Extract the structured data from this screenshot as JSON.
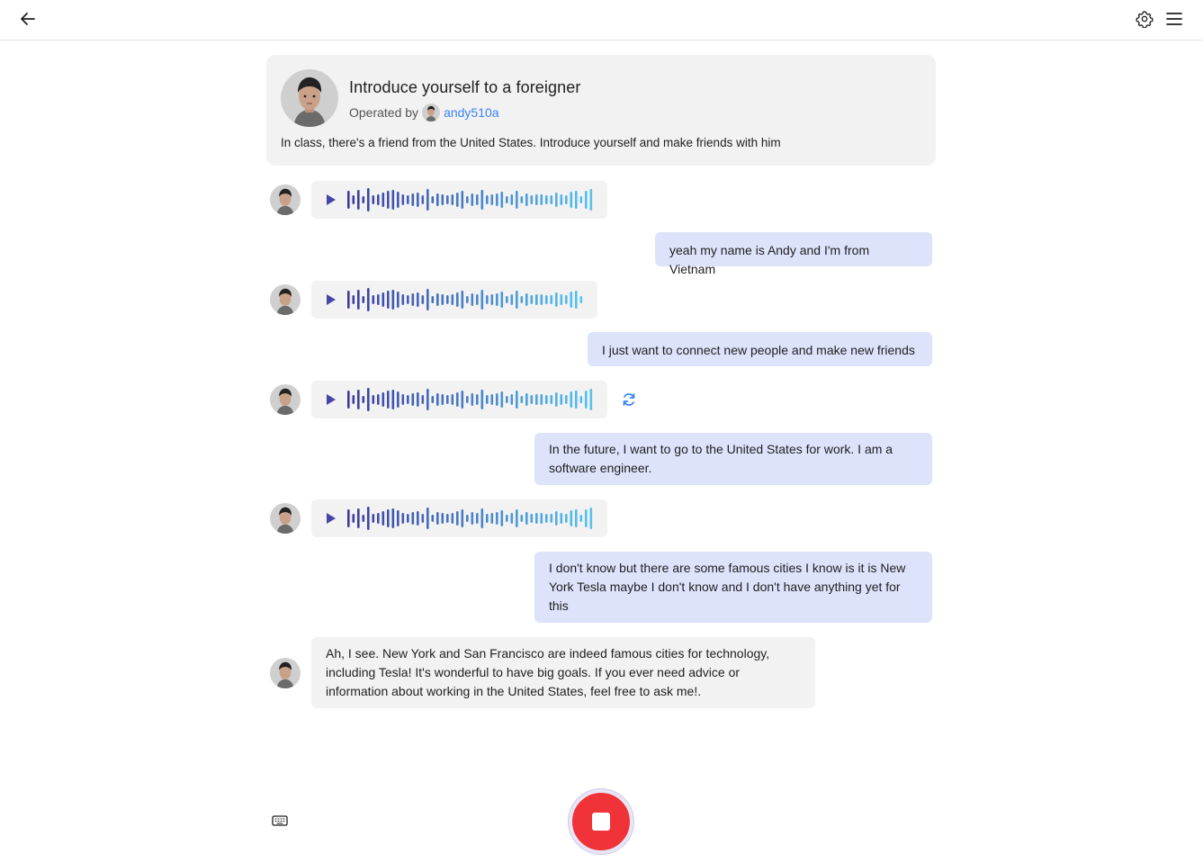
{
  "header": {
    "back_icon": "arrow-left-icon",
    "settings_icon": "gear-icon",
    "menu_icon": "hamburger-menu-icon"
  },
  "scenario": {
    "title": "Introduce yourself to a foreigner",
    "operated_by_label": "Operated by",
    "operator_username": "andy510a",
    "description": "In class, there's a friend from the United States. Introduce yourself and make friends with him"
  },
  "messages": [
    {
      "role": "assistant",
      "type": "audio"
    },
    {
      "role": "user",
      "type": "text",
      "text": "yeah my name is Andy and I'm from Vietnam"
    },
    {
      "role": "assistant",
      "type": "audio"
    },
    {
      "role": "user",
      "type": "text",
      "text": "I just want to connect new people and make new friends"
    },
    {
      "role": "assistant",
      "type": "audio",
      "has_regenerate": true
    },
    {
      "role": "user",
      "type": "text",
      "text": "In the future, I want to go to the United States for work. I am a software engineer."
    },
    {
      "role": "assistant",
      "type": "audio"
    },
    {
      "role": "user",
      "type": "text",
      "text": "I don't know but there are some famous cities I know is it is New York Tesla maybe I don't know and I don't have anything yet for this"
    },
    {
      "role": "assistant",
      "type": "text",
      "text": "Ah, I see. New York and San Francisco are indeed famous cities for technology, including Tesla! It's wonderful to have big goals. If you ever need advice or information about working in the United States, feel free to ask me!."
    }
  ],
  "controls": {
    "keyboard_icon": "keyboard-icon",
    "record_state": "recording",
    "record_icon": "stop-icon"
  },
  "colors": {
    "user_bubble": "#dde3fb",
    "assistant_bubble": "#f2f2f3",
    "link": "#3b82f6",
    "record": "#ef3338",
    "wave_start": "#3d3c9e",
    "wave_end": "#56c3f0"
  }
}
